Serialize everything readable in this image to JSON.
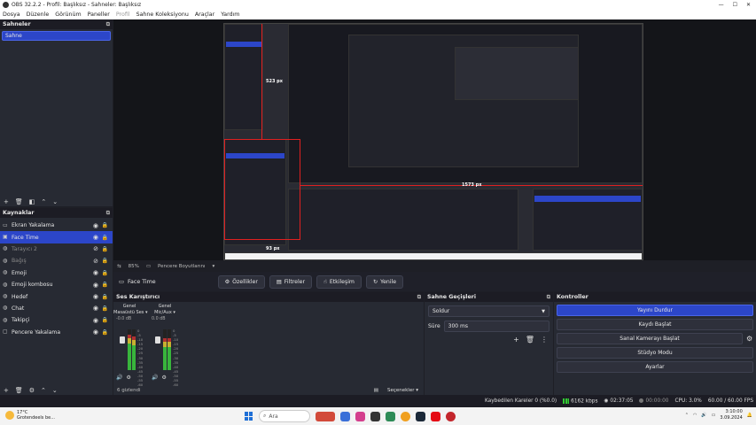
{
  "window": {
    "title": "OBS 32.2.2 - Profil: Başlıksız - Sahneler: Başlıksız"
  },
  "menu": {
    "items": [
      "Dosya",
      "Düzenle",
      "Görünüm",
      "Paneller",
      "Profil",
      "Sahne Koleksiyonu",
      "Araçlar",
      "Yardım"
    ],
    "disabled": [
      "Profil"
    ]
  },
  "scenes": {
    "title": "Sahneler",
    "items": [
      {
        "label": "Sahne"
      }
    ]
  },
  "sources": {
    "title": "Kaynaklar",
    "items": [
      {
        "label": "Ekran Yakalama",
        "icon": "monitor-icon",
        "visible": true
      },
      {
        "label": "Face Time",
        "icon": "camera-icon",
        "visible": true,
        "selected": true
      },
      {
        "label": "Tarayıcı 2",
        "icon": "globe-icon",
        "visible": false
      },
      {
        "label": "Bağış",
        "icon": "globe-icon",
        "visible": false
      },
      {
        "label": "Emoji",
        "icon": "globe-icon",
        "visible": true
      },
      {
        "label": "Emoji kombosu",
        "icon": "globe-icon",
        "visible": true
      },
      {
        "label": "Hedef",
        "icon": "globe-icon",
        "visible": true
      },
      {
        "label": "Chat",
        "icon": "globe-icon",
        "visible": true
      },
      {
        "label": "Takipçi",
        "icon": "globe-icon",
        "visible": true
      },
      {
        "label": "Pencere Yakalama",
        "icon": "window-icon",
        "visible": true
      }
    ]
  },
  "preview": {
    "measure_height": "523 px",
    "measure_width": "1573 px",
    "measure_small": "93 px"
  },
  "preview_status": {
    "zoom": "85%",
    "mode": "Pencere Boyutlarını"
  },
  "properties_bar": {
    "context": "Face Time",
    "buttons": [
      "Özellikler",
      "Filtreler",
      "Etkileşim",
      "Yenile"
    ]
  },
  "mixer": {
    "title": "Ses Karıştırıcı",
    "channels": [
      {
        "header": "Genel",
        "name": "Masaüstü Ses",
        "db": "-0.0 dB"
      },
      {
        "header": "Genel",
        "name": "Mic/Aux",
        "db": "0.0 dB"
      }
    ],
    "scale": [
      "0",
      "-5",
      "-10",
      "-15",
      "-20",
      "-25",
      "-30",
      "-35",
      "-40",
      "-45",
      "-50",
      "-55",
      "-60"
    ],
    "hidden_count": "6 gizlendi",
    "options_label": "Seçenekler"
  },
  "transitions": {
    "title": "Sahne Geçişleri",
    "selected": "Soldur",
    "duration_label": "Süre",
    "duration": "300 ms"
  },
  "controls": {
    "title": "Kontroller",
    "buttons": [
      "Yayını Durdur",
      "Kaydı Başlat",
      "Sanal Kamerayı Başlat",
      "Stüdyo Modu",
      "Ayarlar"
    ]
  },
  "status": {
    "dropped": "Kaybedilen Kareler 0 (%0.0)",
    "bitrate": "6162 kbps",
    "stream_time": "02:37:05",
    "rec_time": "00:00:00",
    "cpu": "CPU: 3.0%",
    "fps": "60.00 / 60.00 FPS"
  },
  "taskbar": {
    "temperature": "17°C",
    "weather": "Grotendeels be...",
    "search": "Ara",
    "time": "3:10:00",
    "date": "3.09.2024"
  },
  "colors": {
    "accent": "#2c46c9",
    "panel": "#272a33",
    "background": "#1e1f26",
    "selection_box": "#e02020"
  }
}
